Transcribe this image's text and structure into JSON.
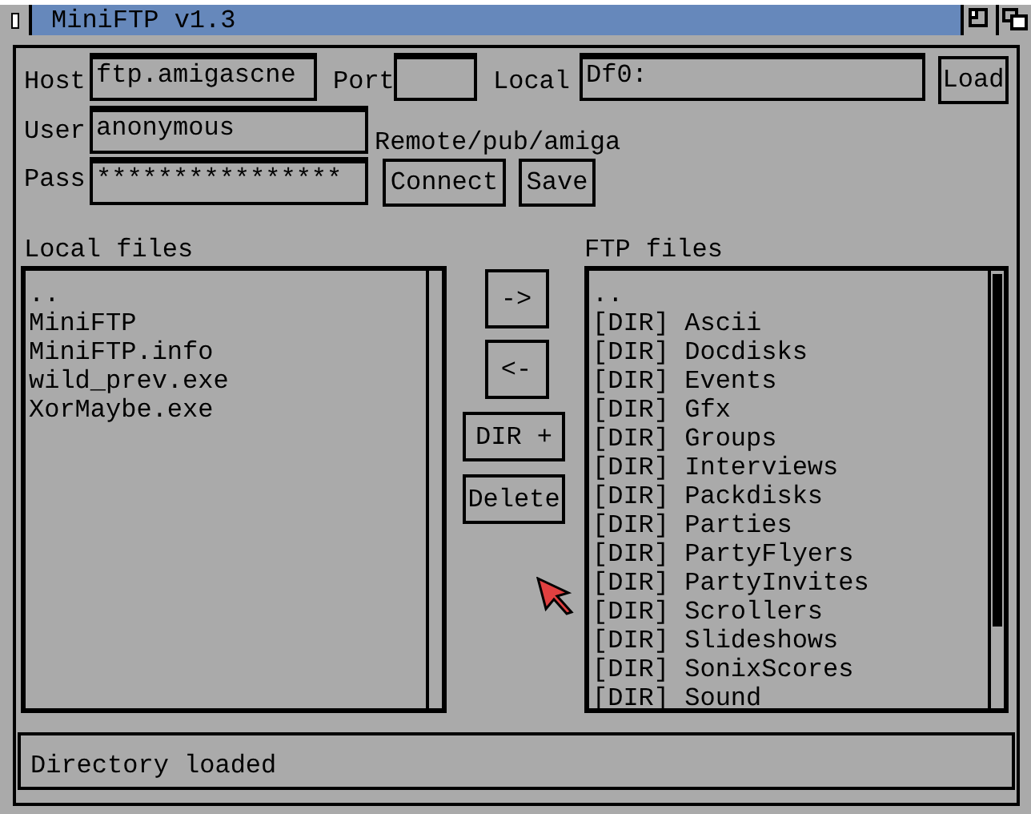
{
  "window": {
    "title": "MiniFTP v1.3"
  },
  "connection": {
    "host_label": "Host",
    "host_value": "ftp.amigascne",
    "port_label": "Port",
    "local_label": "Local",
    "local_value": "Df0:",
    "load_button": "Load",
    "user_label": "User",
    "user_value": "anonymous",
    "remote_label": "Remote",
    "remote_path": "/pub/amiga",
    "pass_label": "Pass",
    "pass_value": "****************",
    "connect_button": "Connect",
    "save_button": "Save"
  },
  "local_files": {
    "title": "Local files",
    "items": [
      "..",
      "MiniFTP",
      "MiniFTP.info",
      "wild_prev.exe",
      "XorMaybe.exe"
    ]
  },
  "transfer_buttons": [
    "->",
    "<-",
    "DIR +",
    "Delete"
  ],
  "ftp_files": {
    "title": "FTP files",
    "items": [
      "..",
      "[DIR] Ascii",
      "[DIR] Docdisks",
      "[DIR] Events",
      "[DIR] Gfx",
      "[DIR] Groups",
      "[DIR] Interviews",
      "[DIR] Packdisks",
      "[DIR] Parties",
      "[DIR] PartyFlyers",
      "[DIR] PartyInvites",
      "[DIR] Scrollers",
      "[DIR] Slideshows",
      "[DIR] SonixScores",
      "[DIR] Sound"
    ]
  },
  "status_bar": {
    "text": "Directory loaded"
  }
}
